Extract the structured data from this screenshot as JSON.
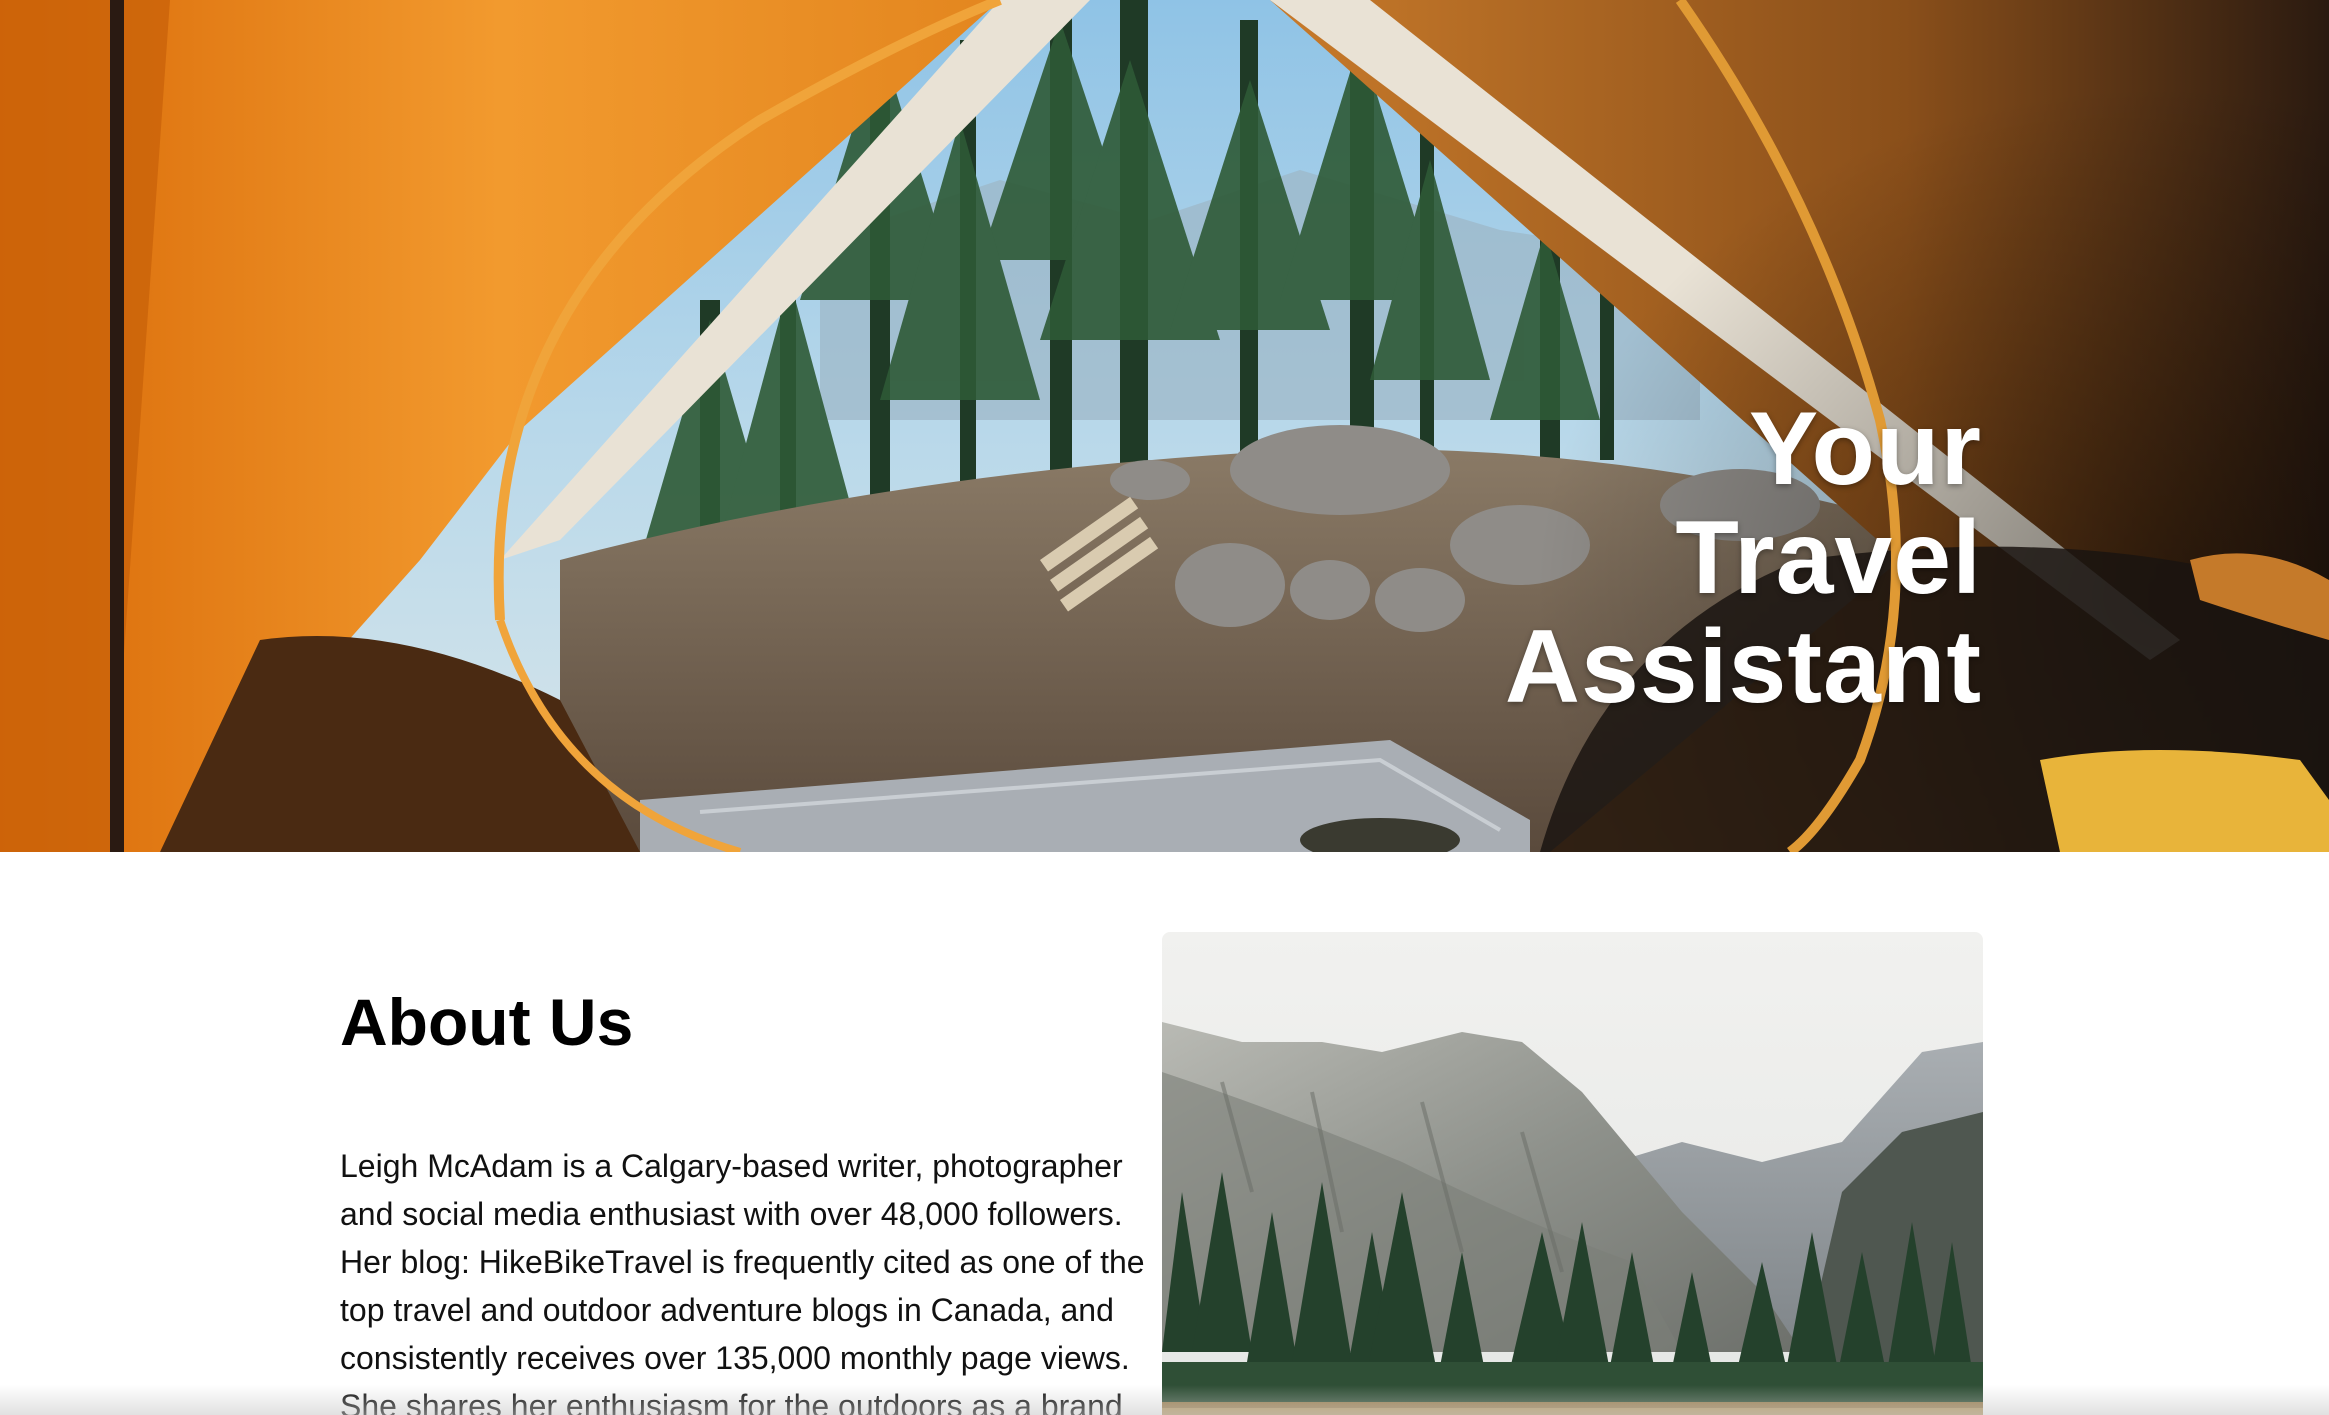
{
  "hero": {
    "title_lines": [
      "Your",
      "Travel",
      "Assistant"
    ],
    "image_icon": "tent-view-photo"
  },
  "about": {
    "heading": "About Us",
    "body": "Leigh McAdam is a Calgary-based writer, photographer and social media enthusiast with over 48,000 followers. Her blog: HikeBikeTravel is frequently cited as one of the top travel and outdoor adventure blogs in Canada, and consistently receives over 135,000 monthly page views. She shares her enthusiasm for the outdoors as a brand",
    "image_icon": "mountain-valley-photo"
  },
  "colors": {
    "tent_orange": "#e8891c",
    "title_white": "#ffffff",
    "text_black": "#111111"
  }
}
